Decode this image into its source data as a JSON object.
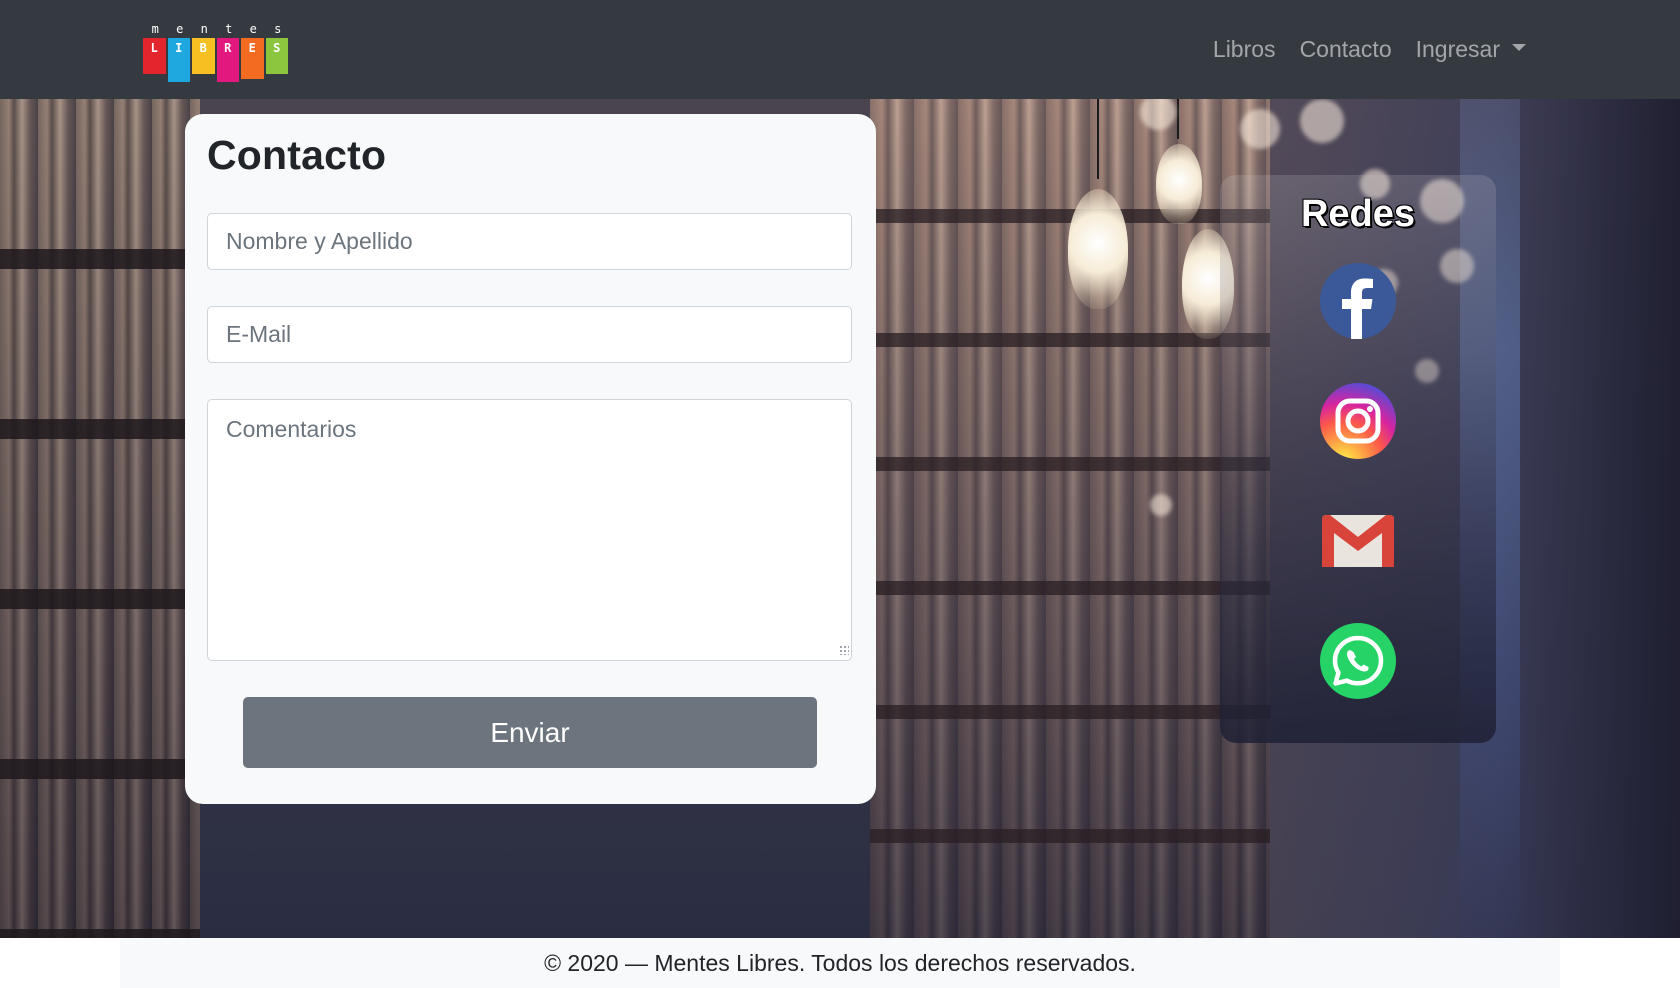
{
  "brand": {
    "top_letters": [
      "m",
      "e",
      "n",
      "t",
      "e",
      "s"
    ],
    "blocks": [
      {
        "letter": "L",
        "color": "#e3262e"
      },
      {
        "letter": "I",
        "color": "#1fa7e0"
      },
      {
        "letter": "B",
        "color": "#f6c022"
      },
      {
        "letter": "R",
        "color": "#e2187f"
      },
      {
        "letter": "E",
        "color": "#f26b21"
      },
      {
        "letter": "S",
        "color": "#8cc63f"
      }
    ]
  },
  "nav": {
    "libros": "Libros",
    "contacto": "Contacto",
    "ingresar": "Ingresar"
  },
  "contact": {
    "title": "Contacto",
    "name_placeholder": "Nombre y Apellido",
    "email_placeholder": "E-Mail",
    "comments_placeholder": "Comentarios",
    "send_label": "Enviar"
  },
  "social": {
    "title": "Redes",
    "icons": [
      "facebook-icon",
      "instagram-icon",
      "gmail-icon",
      "whatsapp-icon"
    ]
  },
  "footer": {
    "text": "© 2020 — Mentes Libres. Todos los derechos reservados."
  },
  "colors": {
    "navbar": "#343a40",
    "card": "#f8f9fa",
    "button": "#6c757d",
    "facebook": "#3b5998",
    "whatsapp": "#25d366"
  }
}
